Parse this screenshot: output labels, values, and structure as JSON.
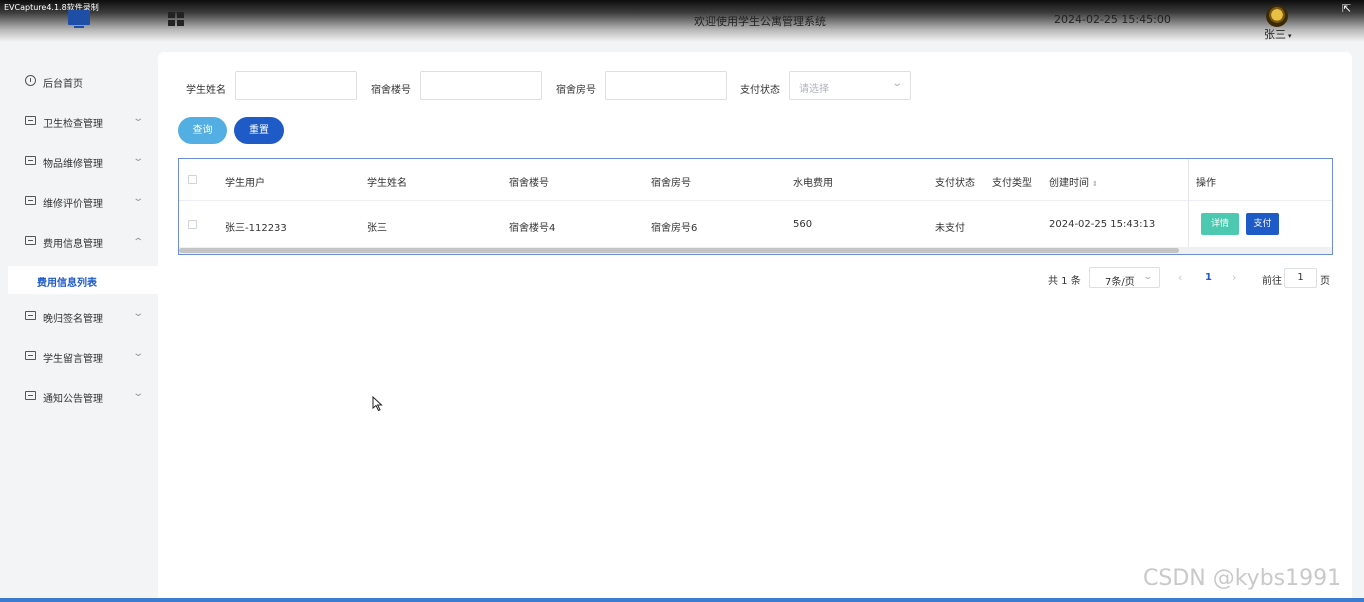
{
  "app": {
    "window_title": "EVCapture4.1.8软件录制",
    "system_title": "欢迎使用学生公寓管理系统",
    "datetime": "2024-02-25 15:45:00",
    "user_name": "张三"
  },
  "sidebar": {
    "items": [
      {
        "label": "后台首页"
      },
      {
        "label": "卫生检查管理"
      },
      {
        "label": "物品维修管理"
      },
      {
        "label": "维修评价管理"
      },
      {
        "label": "费用信息管理"
      },
      {
        "label": "晚归签名管理"
      },
      {
        "label": "学生留言管理"
      },
      {
        "label": "通知公告管理"
      }
    ],
    "active_sub": "费用信息列表"
  },
  "filters": {
    "student_name_label": "学生姓名",
    "building_label": "宿舍楼号",
    "room_label": "宿舍房号",
    "pay_status_label": "支付状态",
    "pay_status_placeholder": "请选择",
    "query_button": "查询",
    "reset_button": "重置"
  },
  "table": {
    "columns": [
      "学生用户",
      "学生姓名",
      "宿舍楼号",
      "宿舍房号",
      "水电费用",
      "支付状态",
      "支付类型",
      "创建时间",
      "操作"
    ],
    "rows": [
      {
        "student_user": "张三-112233",
        "student_name": "张三",
        "building": "宿舍楼号4",
        "room": "宿舍房号6",
        "fee": "560",
        "pay_status": "未支付",
        "pay_type": "",
        "created": "2024-02-25 15:43:13",
        "detail_button": "详情",
        "pay_button": "支付"
      }
    ]
  },
  "pagination": {
    "total": "共 1 条",
    "page_size": "7条/页",
    "current_page": "1",
    "goto_label": "前往",
    "goto_value": "1",
    "goto_unit": "页"
  },
  "watermark": "CSDN @kybs1991",
  "colors": {
    "primary": "#1e5bc6",
    "query": "#52aee3",
    "detail": "#4cc9b0"
  }
}
